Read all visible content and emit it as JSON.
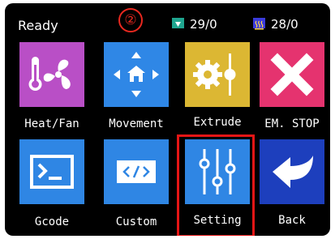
{
  "status_bar": {
    "state": "Ready",
    "step_marker": "②",
    "nozzle_temp": "29/0",
    "bed_temp": "28/0",
    "nozzle_icon": "nozzle-temperature-icon",
    "bed_icon": "heated-bed-icon"
  },
  "menu": {
    "items": [
      {
        "label": "Heat/Fan",
        "icon": "thermometer-fan-icon",
        "color": "#b94fc6"
      },
      {
        "label": "Movement",
        "icon": "move-arrows-icon",
        "color": "#2f87e6"
      },
      {
        "label": "Extrude",
        "icon": "extruder-gear-icon",
        "color": "#dcb733"
      },
      {
        "label": "EM. STOP",
        "icon": "close-x-icon",
        "color": "#e5336f"
      },
      {
        "label": "Gcode",
        "icon": "terminal-icon",
        "color": "#2f86e4"
      },
      {
        "label": "Custom",
        "icon": "code-tag-icon",
        "color": "#2f86e4"
      },
      {
        "label": "Setting",
        "icon": "sliders-icon",
        "color": "#2f86e4"
      },
      {
        "label": "Back",
        "icon": "back-arrow-icon",
        "color": "#1d3fbd"
      }
    ]
  },
  "colors": {
    "background": "#000000",
    "highlight": "#e51515",
    "marker": "#e8281f"
  }
}
